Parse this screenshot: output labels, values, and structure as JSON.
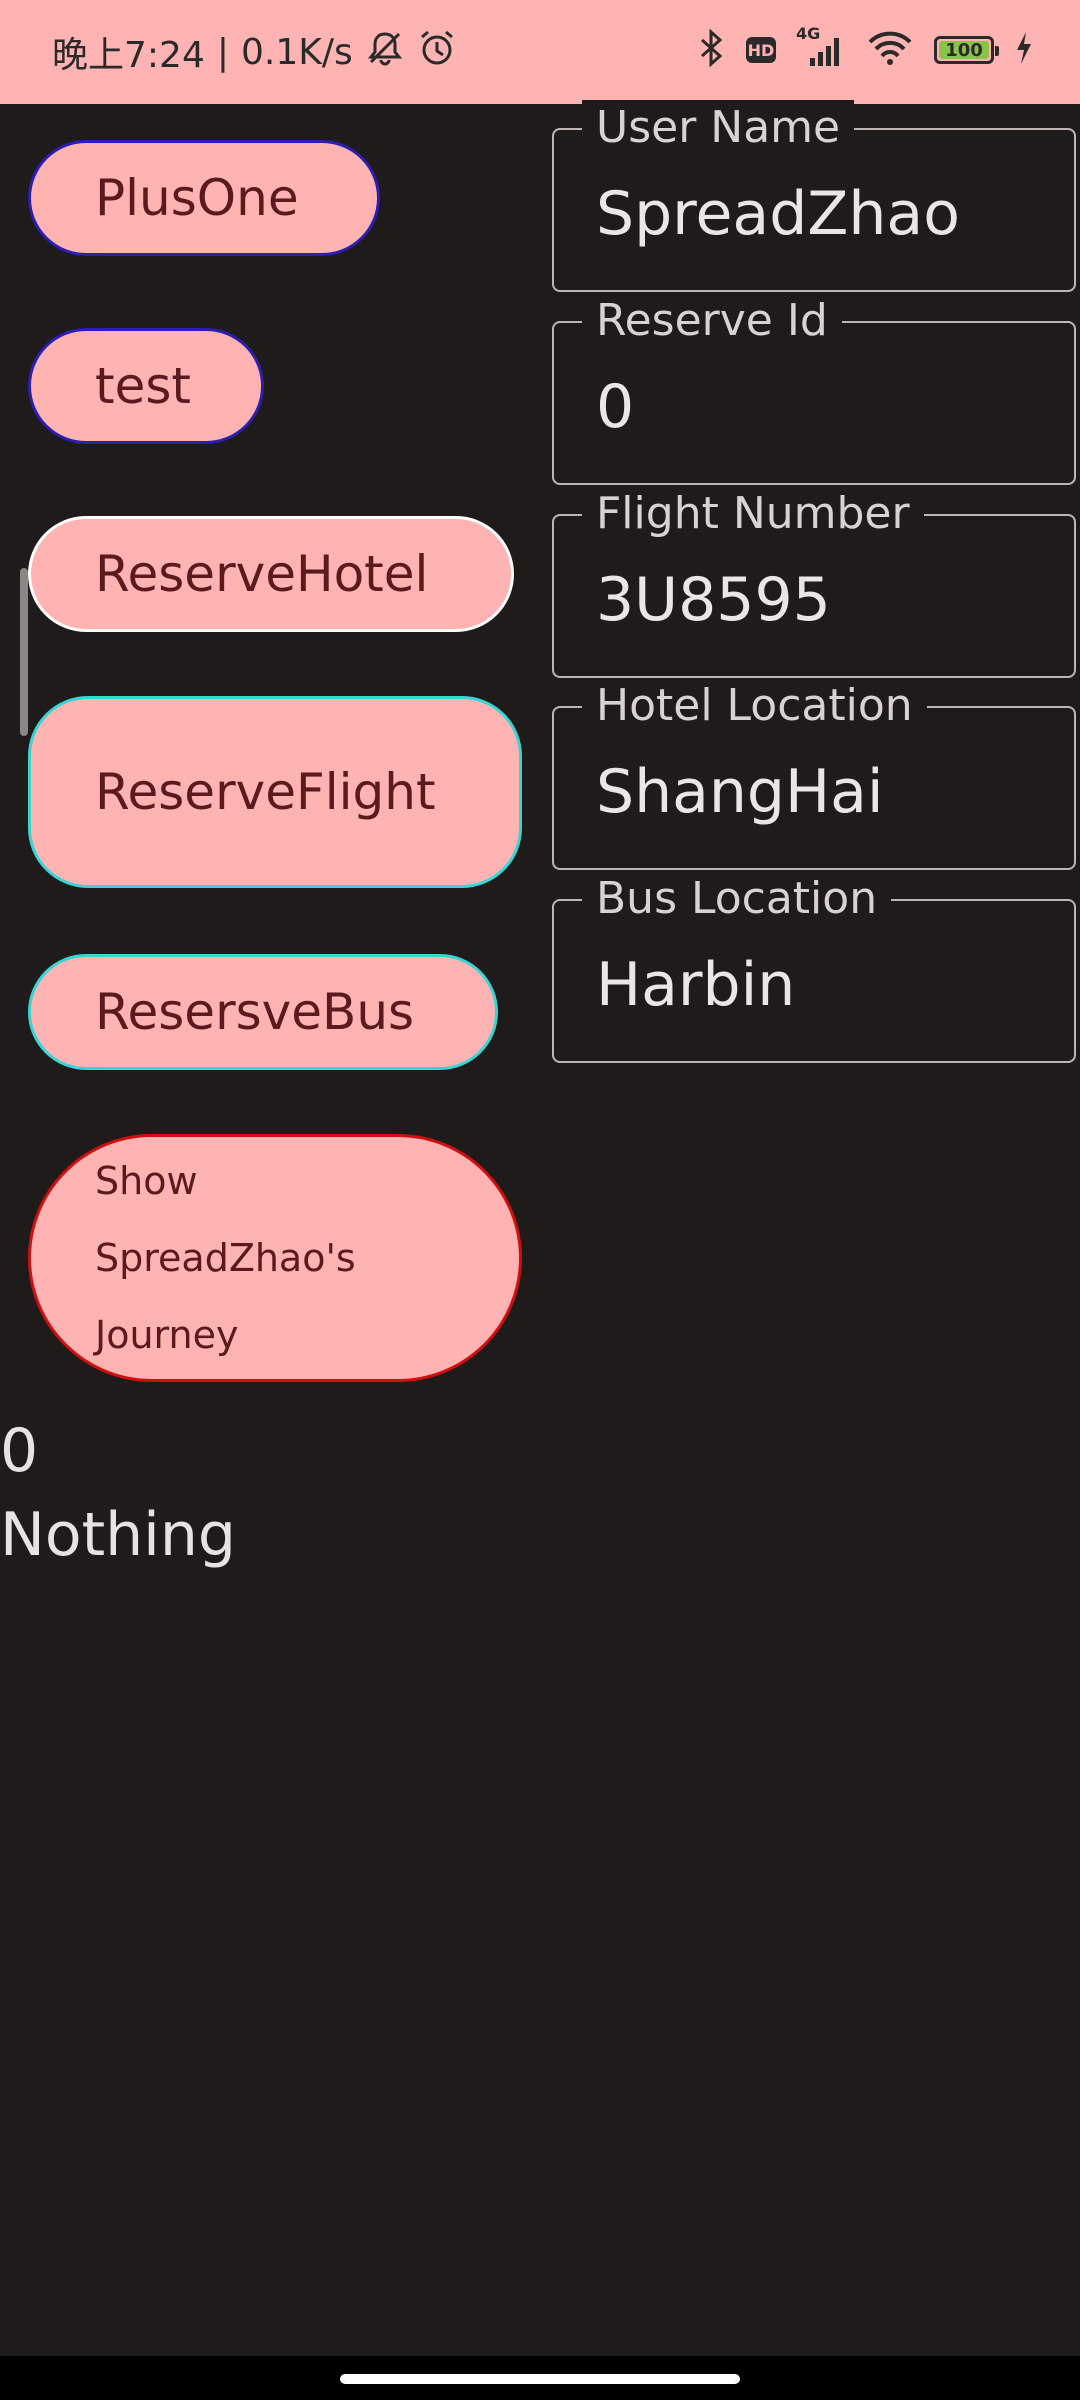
{
  "status_bar": {
    "time_label": "晚上7:24",
    "separator": "|",
    "net_speed": "0.1K/s",
    "hd_label": "HD",
    "network_label": "4G",
    "battery_level": "100",
    "battery_fraction": 1.0,
    "bg_color": "#ffb3b3"
  },
  "buttons": {
    "plus_one": "PlusOne",
    "test": "test",
    "reserve_hotel": "ReserveHotel",
    "reserve_flight": "ReserveFlight",
    "reserve_bus": "ResersveBus",
    "show_journey": "Show SpreadZhao's Journey"
  },
  "output": {
    "count": "0",
    "message": "Nothing"
  },
  "fields": {
    "user_name": {
      "label": "User Name",
      "value": "SpreadZhao"
    },
    "reserve_id": {
      "label": "Reserve Id",
      "value": "0"
    },
    "flight_number": {
      "label": "Flight Number",
      "value": "3U8595"
    },
    "hotel_location": {
      "label": "Hotel Location",
      "value": "ShangHai"
    },
    "bus_location": {
      "label": "Bus Location",
      "value": "Harbin"
    }
  },
  "colors": {
    "background": "#1f1b1b",
    "button_fill": "#ffb3b3",
    "button_text": "#5a1a1e",
    "border_blue": "#2a1fb0",
    "border_white": "#ffffff",
    "border_cyan": "#36d6d6",
    "border_red": "#d01010",
    "field_border": "#bfb5b5"
  }
}
